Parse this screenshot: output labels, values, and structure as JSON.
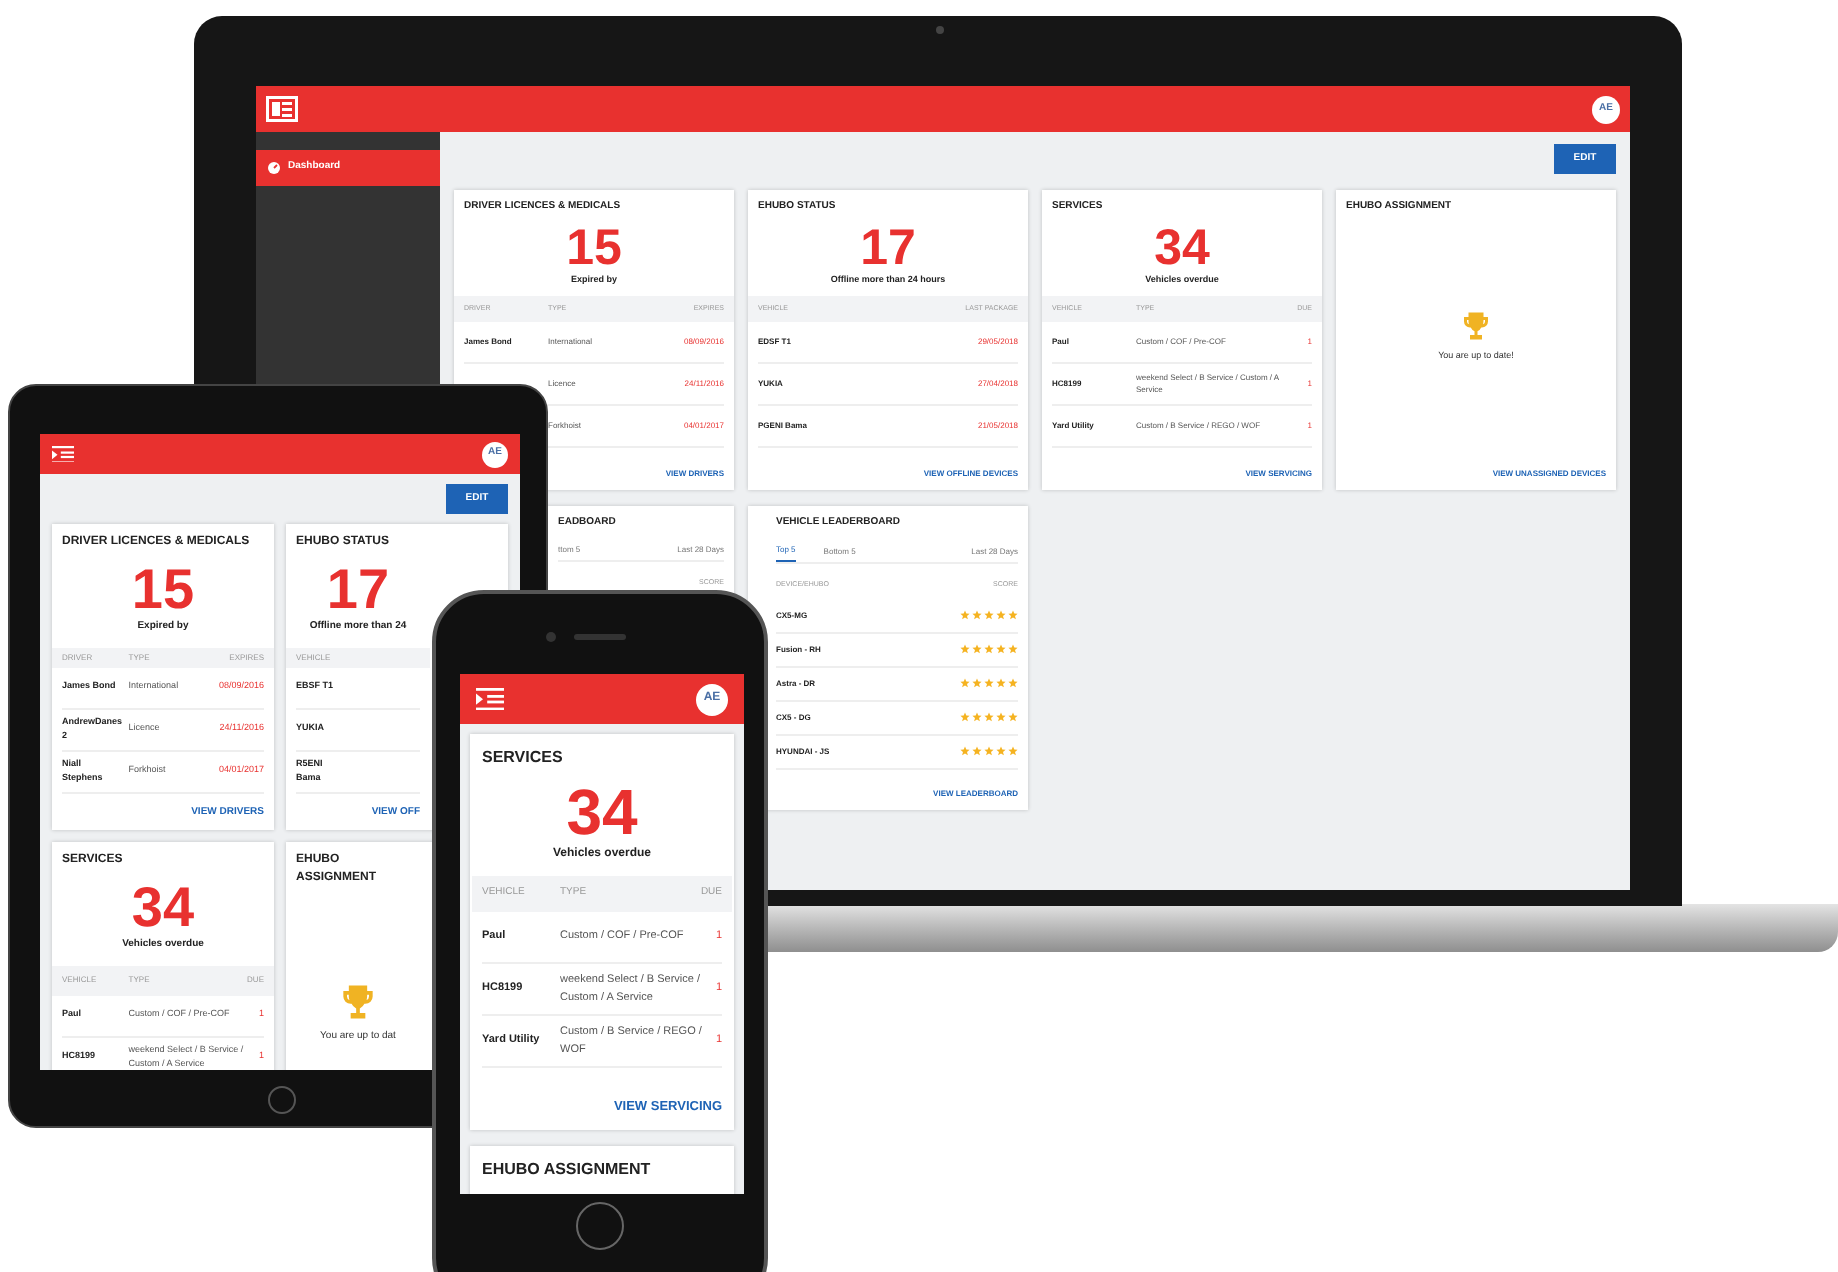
{
  "laptop": {
    "header": {
      "avatar": "AE"
    },
    "sidebar": {
      "items": [
        {
          "label": "Dashboard",
          "selected": true
        }
      ]
    },
    "edit_button": "EDIT",
    "cards": [
      {
        "kind": "stat",
        "title": "DRIVER LICENCES & MEDICALS",
        "figure": "15",
        "caption": "Expired by",
        "columns": {
          "name": "DRIVER",
          "detail": "TYPE",
          "value": "EXPIRES"
        },
        "rows": [
          {
            "name": "James Bond",
            "detail": "International",
            "value": "08/09/2016"
          },
          {
            "detail": "Licence",
            "value": "24/11/2016"
          },
          {
            "detail": "Forkhoist",
            "value": "04/01/2017"
          }
        ],
        "link": "VIEW DRIVERS"
      },
      {
        "kind": "stat",
        "title": "EHUBO STATUS",
        "figure": "17",
        "caption": "Offline more than 24 hours",
        "columns": {
          "name": "VEHICLE",
          "value": "LAST PACKAGE"
        },
        "rows": [
          {
            "name": "EDSF T1",
            "value": "29/05/2018"
          },
          {
            "name": "YUKIA",
            "value": "27/04/2018"
          },
          {
            "name": "PGENI Bama",
            "value": "21/05/2018"
          }
        ],
        "link": "VIEW OFFLINE DEVICES"
      },
      {
        "kind": "stat",
        "title": "SERVICES",
        "figure": "34",
        "caption": "Vehicles overdue",
        "columns": {
          "name": "VEHICLE",
          "detail": "TYPE",
          "value": "DUE"
        },
        "rows": [
          {
            "name": "Paul",
            "detail": "Custom / COF / Pre-COF",
            "value": "1"
          },
          {
            "name": "HC8199",
            "detail": "weekend Select / B Service / Custom / A Service",
            "value": "1"
          },
          {
            "name": "Yard Utility",
            "detail": "Custom / B Service / REGO / WOF",
            "value": "1"
          }
        ],
        "link": "VIEW SERVICING"
      },
      {
        "kind": "assignment",
        "title": "EHUBO ASSIGNMENT",
        "message": "You are up to date!",
        "link": "VIEW UNASSIGNED DEVICES"
      },
      {
        "kind": "leaderboard",
        "title": "EADBOARD",
        "tabs": [
          {
            "label": "ttom 5",
            "selected": false
          }
        ],
        "period": "Last 28 Days",
        "columns": {
          "value": "SCORE"
        }
      },
      {
        "kind": "leaderboard",
        "title": "VEHICLE LEADERBOARD",
        "tabs": [
          {
            "label": "Top 5",
            "selected": true
          },
          {
            "label": "Bottom 5",
            "selected": false
          }
        ],
        "period": "Last 28 Days",
        "columns": {
          "name": "DEVICE/EHUBO",
          "value": "SCORE"
        },
        "rows": [
          {
            "name": "CX5-MG",
            "stars": 5
          },
          {
            "name": "Fusion - RH",
            "stars": 5
          },
          {
            "name": "Astra - DR",
            "stars": 5
          },
          {
            "name": "CX5 - DG",
            "stars": 5
          },
          {
            "name": "HYUNDAI - JS",
            "stars": 5
          }
        ],
        "link": "VIEW LEADERBOARD"
      }
    ]
  },
  "tablet": {
    "header": {
      "avatar": "AE"
    },
    "edit_button": "EDIT",
    "cards": [
      {
        "kind": "stat",
        "title": "DRIVER LICENCES & MEDICALS",
        "figure": "15",
        "caption": "Expired by",
        "columns": {
          "name": "DRIVER",
          "detail": "TYPE",
          "value": "EXPIRES"
        },
        "rows": [
          {
            "name": "James Bond",
            "detail": "International",
            "value": "08/09/2016"
          },
          {
            "name": "AndrewDanes 2",
            "detail": "Licence",
            "value": "24/11/2016"
          },
          {
            "name": "Niall Stephens",
            "detail": "Forkhoist",
            "value": "04/01/2017"
          }
        ],
        "link": "VIEW DRIVERS"
      },
      {
        "kind": "stat",
        "title": "EHUBO STATUS",
        "figure": "17",
        "caption": "Offline more than 24",
        "columns": {
          "name": "VEHICLE"
        },
        "rows": [
          {
            "name": "EBSF T1"
          },
          {
            "name": "YUKIA"
          },
          {
            "name": "R5ENI Bama"
          }
        ],
        "link": "VIEW OFF"
      },
      {
        "kind": "stat",
        "title": "SERVICES",
        "figure": "34",
        "caption": "Vehicles overdue",
        "columns": {
          "name": "VEHICLE",
          "detail": "TYPE",
          "value": "DUE"
        },
        "rows": [
          {
            "name": "Paul",
            "detail": "Custom / COF / Pre-COF",
            "value": "1"
          },
          {
            "name": "HC8199",
            "detail": "weekend Select / B Service / Custom / A Service",
            "value": "1"
          }
        ]
      },
      {
        "kind": "assignment",
        "title": "EHUBO ASSIGNMENT",
        "message": "You are up to dat"
      }
    ]
  },
  "phone": {
    "header": {
      "avatar": "AE"
    },
    "cards": [
      {
        "kind": "stat",
        "title": "SERVICES",
        "figure": "34",
        "caption": "Vehicles overdue",
        "columns": {
          "name": "VEHICLE",
          "detail": "TYPE",
          "value": "DUE"
        },
        "rows": [
          {
            "name": "Paul",
            "detail": "Custom / COF / Pre-COF",
            "value": "1"
          },
          {
            "name": "HC8199",
            "detail": "weekend Select / B Service / Custom / A Service",
            "value": "1"
          },
          {
            "name": "Yard Utility",
            "detail": "Custom / B Service / REGO / WOF",
            "value": "1"
          }
        ],
        "link": "VIEW SERVICING"
      },
      {
        "kind": "assignment",
        "title": "EHUBO ASSIGNMENT"
      }
    ]
  }
}
